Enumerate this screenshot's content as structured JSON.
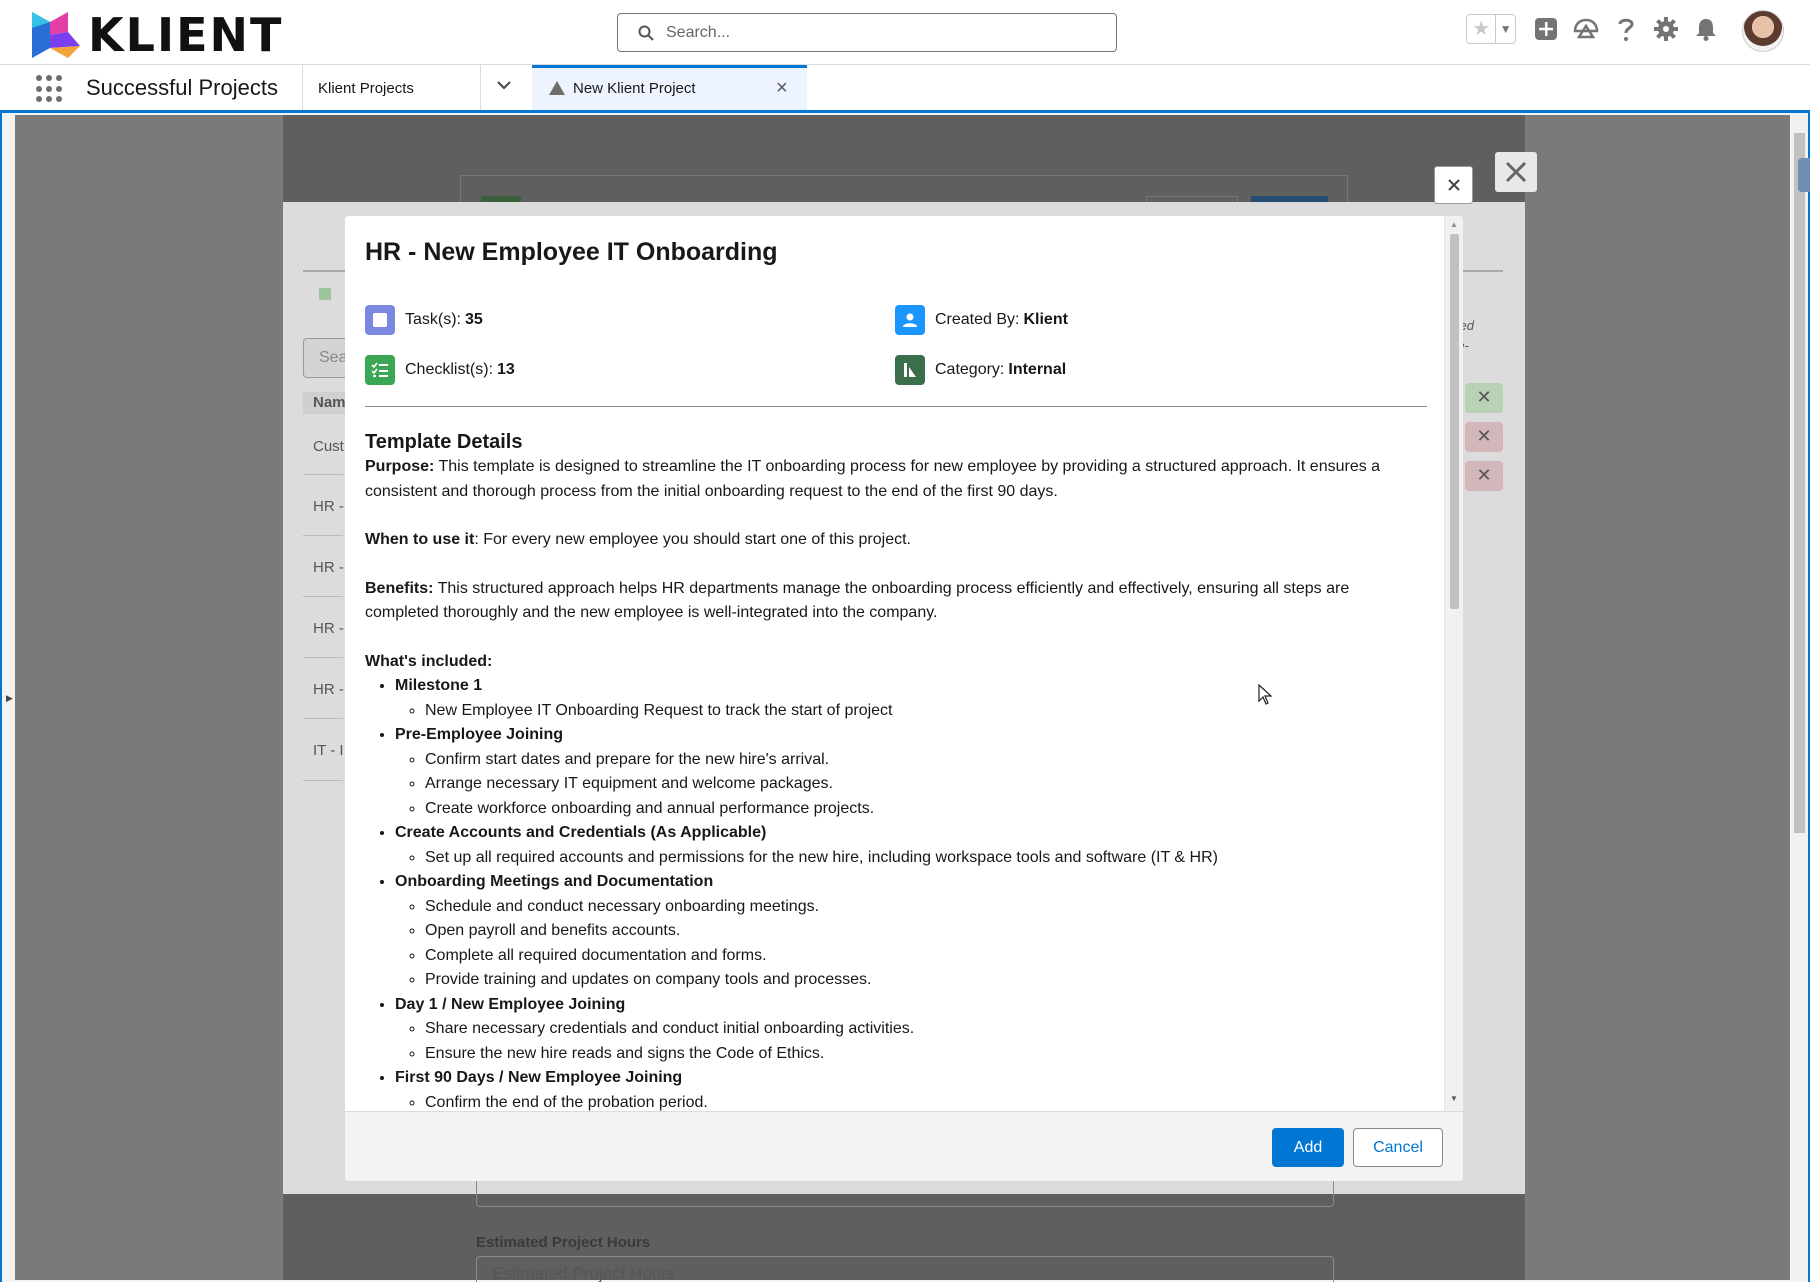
{
  "header": {
    "brand": "KLIENT",
    "search_placeholder": "Search...",
    "icons": [
      "favorites-star-icon",
      "add-icon",
      "trailhead-icon",
      "help-icon",
      "setup-gear-icon",
      "notifications-bell-icon"
    ]
  },
  "nav": {
    "app_name": "Successful Projects",
    "object_tab": "Klient Projects",
    "active_tab": "New Klient Project"
  },
  "background": {
    "search_stub": "Sea",
    "column_header": "Nam",
    "rows": [
      "Cust",
      "HR -",
      "HR -",
      "HR -",
      "HR -",
      "IT - I"
    ],
    "italic_1": "ved",
    "italic_2": "re-",
    "field_label": "Estimated Project Hours",
    "field_placeholder": "Estimated Project Hours"
  },
  "modal": {
    "title": "HR - New Employee IT Onboarding",
    "meta": {
      "tasks_label": "Task(s):",
      "tasks_value": "35",
      "checklists_label": "Checklist(s):",
      "checklists_value": "13",
      "created_by_label": "Created By:",
      "created_by_value": "Klient",
      "category_label": "Category:",
      "category_value": "Internal"
    },
    "details_heading": "Template Details",
    "purpose_label": "Purpose:",
    "purpose_text": " This template is designed to streamline the IT onboarding process for new employee by providing a structured approach. It ensures a consistent and thorough process from the initial onboarding request to the end of the first 90 days.",
    "when_label": "When to use it",
    "when_text": ": For every new employee you should start one of this project.",
    "benefits_label": "Benefits:",
    "benefits_text": " This structured approach helps HR departments manage the onboarding process efficiently and effectively, ensuring all steps are completed thoroughly and the new employee is well-integrated into the company.",
    "included_label": "What's included:",
    "sections": [
      {
        "title": "Milestone 1",
        "items": [
          "New Employee IT Onboarding Request to track the start of project"
        ]
      },
      {
        "title": "Pre-Employee Joining",
        "items": [
          "Confirm start dates and prepare for the new hire's arrival.",
          "Arrange necessary IT equipment and welcome packages.",
          "Create workforce onboarding and annual performance projects."
        ]
      },
      {
        "title": "Create Accounts and Credentials (As Applicable)",
        "items": [
          "Set up all required accounts and permissions for the new hire, including workspace tools and software (IT & HR)"
        ]
      },
      {
        "title": "Onboarding Meetings and Documentation",
        "items": [
          "Schedule and conduct necessary onboarding meetings.",
          "Open payroll and benefits accounts.",
          "Complete all required documentation and forms.",
          "Provide training and updates on company tools and processes."
        ]
      },
      {
        "title": "Day 1 / New Employee Joining",
        "items": [
          "Share necessary credentials and conduct initial onboarding activities.",
          "Ensure the new hire reads and signs the Code of Ethics."
        ]
      },
      {
        "title": "First 90 Days / New Employee Joining",
        "items": [
          "Confirm the end of the probation period."
        ]
      }
    ],
    "add_label": "Add",
    "cancel_label": "Cancel"
  },
  "colors": {
    "brand_blue": "#0176d3",
    "task_icon": "#7b88e0",
    "checklist_icon": "#3ba755",
    "created_by_icon": "#1b96ff",
    "category_icon": "#3b6e4a"
  }
}
